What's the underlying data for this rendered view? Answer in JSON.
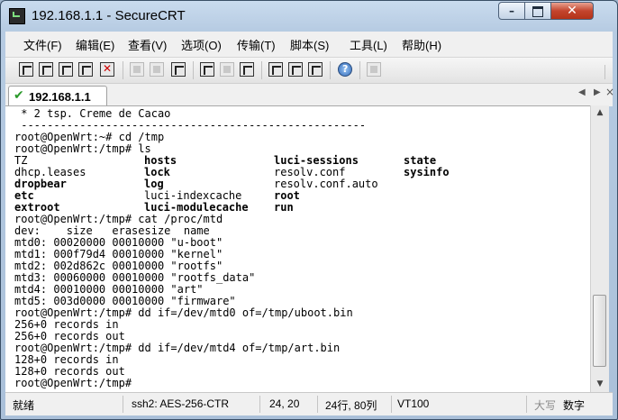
{
  "window": {
    "title": "192.168.1.1 - SecureCRT"
  },
  "menu": [
    "文件(F)",
    "编辑(E)",
    "查看(V)",
    "选项(O)",
    "传输(T)",
    "脚本(S)",
    "工具(L)",
    "帮助(H)"
  ],
  "tab": {
    "label": "192.168.1.1"
  },
  "terminal": {
    "lines": [
      [
        " * 2 tsp. Creme de Cacao"
      ],
      [
        " -----------------------------------------------------"
      ],
      [
        "root@OpenWrt:~# cd /tmp"
      ],
      [
        "root@OpenWrt:/tmp# ls"
      ],
      [
        "TZ",
        "hosts",
        "luci-sessions",
        "state"
      ],
      [
        "dhcp.leases",
        "lock",
        "resolv.conf",
        "sysinfo"
      ],
      [
        "dropbear",
        "log",
        "resolv.conf.auto"
      ],
      [
        "etc",
        "luci-indexcache",
        "root"
      ],
      [
        "extroot",
        "luci-modulecache",
        "run"
      ],
      [
        "root@OpenWrt:/tmp# cat /proc/mtd"
      ],
      [
        "dev:    size   erasesize  name"
      ],
      [
        "mtd0: 00020000 00010000 \"u-boot\""
      ],
      [
        "mtd1: 000f79d4 00010000 \"kernel\""
      ],
      [
        "mtd2: 002d862c 00010000 \"rootfs\""
      ],
      [
        "mtd3: 00060000 00010000 \"rootfs_data\""
      ],
      [
        "mtd4: 00010000 00010000 \"art\""
      ],
      [
        "mtd5: 003d0000 00010000 \"firmware\""
      ],
      [
        "root@OpenWrt:/tmp# dd if=/dev/mtd0 of=/tmp/uboot.bin"
      ],
      [
        "256+0 records in"
      ],
      [
        "256+0 records out"
      ],
      [
        "root@OpenWrt:/tmp# dd if=/dev/mtd4 of=/tmp/art.bin"
      ],
      [
        "128+0 records in"
      ],
      [
        "128+0 records out"
      ],
      [
        "root@OpenWrt:/tmp# "
      ]
    ]
  },
  "status": {
    "ready": "就绪",
    "cipher": "ssh2: AES-256-CTR",
    "cursor": "24,  20",
    "size": "24行, 80列",
    "emulation": "VT100",
    "caps": "大写",
    "num": "数字"
  }
}
